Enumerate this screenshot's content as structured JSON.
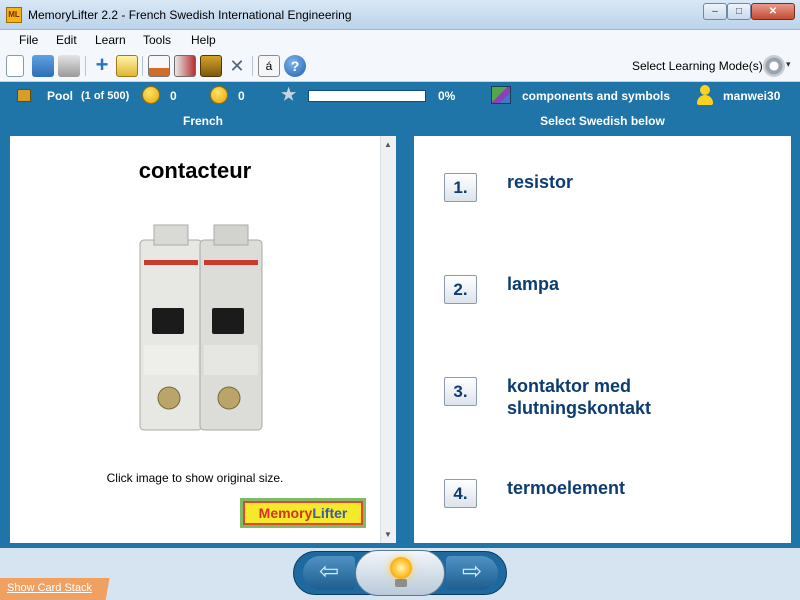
{
  "window": {
    "title": "MemoryLifter 2.2 - French Swedish International Engineering",
    "app_icon_text": "ML",
    "minimize": "–",
    "maximize": "□",
    "close": "✕"
  },
  "menu": [
    "File",
    "Edit",
    "Learn",
    "Tools",
    "Help"
  ],
  "toolbar": {
    "icons": [
      "new-document-icon",
      "open-folder-icon",
      "print-icon",
      "add-card-icon",
      "edit-icon",
      "presentation-icon",
      "statistics-icon",
      "box-icon",
      "settings-tools-icon",
      "character-map-icon",
      "help-icon"
    ],
    "char_map_label": "á",
    "help_label": "?",
    "mode_label": "Select Learning Mode(s)",
    "mode_caret": "▾"
  },
  "status": {
    "pool_label": "Pool",
    "pool_count": "(1 of 500)",
    "right_count": "0",
    "wrong_count": "0",
    "progress_percent_label": "0%",
    "progress_fraction": 0.0,
    "chapter": "components and symbols",
    "user": "manwei30"
  },
  "question": {
    "header": "French",
    "word": "contacteur",
    "image_hint": "Click image to show original size.",
    "logo_m": "Memory",
    "logo_l": "Lifter"
  },
  "answers": {
    "header": "Select Swedish below",
    "items": [
      {
        "num": "1.",
        "text": "resistor"
      },
      {
        "num": "2.",
        "text": "lampa"
      },
      {
        "num": "3.",
        "text": "kontaktor med slutningskontakt"
      },
      {
        "num": "4.",
        "text": "termoelement"
      }
    ]
  },
  "nav": {
    "prev": "⇦",
    "next": "⇨",
    "show_card_stack": "Show Card Stack"
  },
  "colors": {
    "accent_blue": "#1f74a8",
    "answer_text": "#0d3d70",
    "progress_green": "#4fb84c"
  }
}
